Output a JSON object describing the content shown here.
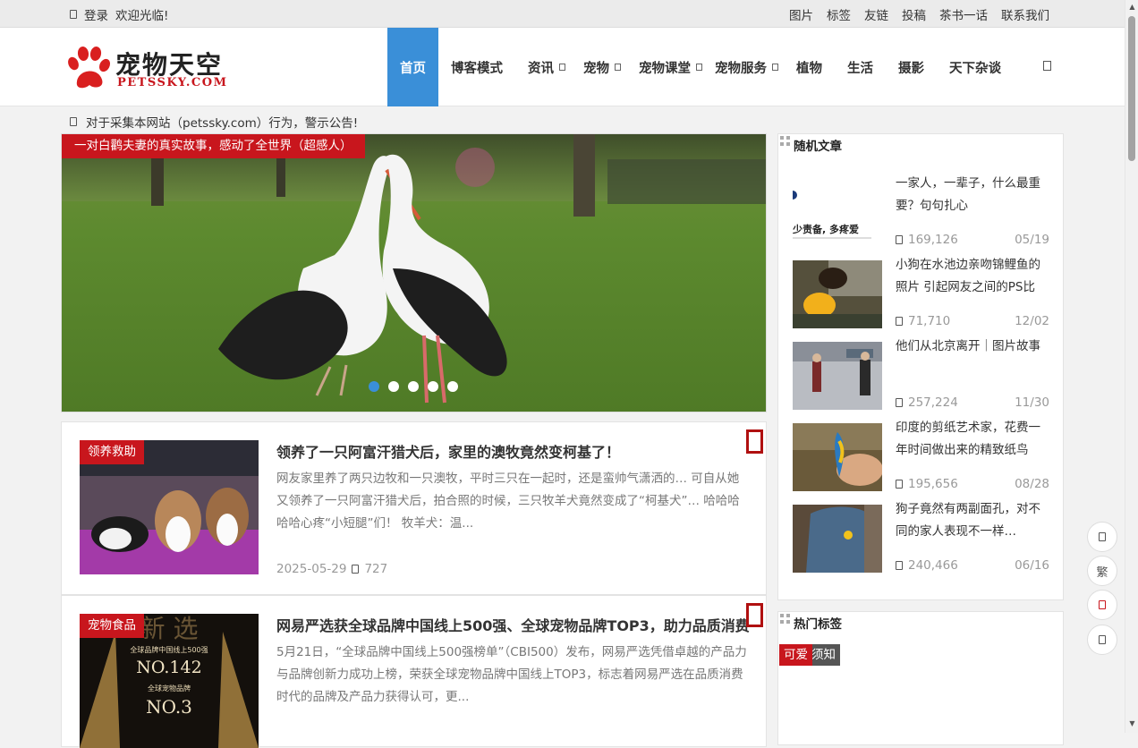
{
  "topbar": {
    "login": "登录",
    "welcome": "欢迎光临!",
    "links": [
      "图片",
      "标签",
      "友链",
      "投稿",
      "茶书一话",
      "联系我们"
    ]
  },
  "logo": {
    "cn": "宠物天空",
    "en": "PETSSKY.COM"
  },
  "nav": {
    "items": [
      "首页",
      "博客模式",
      "资讯",
      "宠物",
      "宠物课堂",
      "宠物服务",
      "植物",
      "生活",
      "摄影",
      "天下杂谈"
    ]
  },
  "notice": "对于采集本网站（petssky.com）行为，警示公告!",
  "slider": {
    "caption": "一对白鹳夫妻的真实故事，感动了全世界（超感人）",
    "active_dot": 1,
    "dot_count": 5
  },
  "posts": [
    {
      "tag": "领养救助",
      "title": "领养了一只阿富汗猎犬后，家里的澳牧竟然变柯基了！",
      "excerpt": "网友家里养了两只边牧和一只澳牧，平时三只在一起时，还是蛮帅气潇洒的… 可自从她又领养了一只阿富汗猎犬后，拍合照的时候，三只牧羊犬竟然变成了“柯基犬”… 哈哈哈哈哈心疼“小短腿”们！ 牧羊犬：温...",
      "date": "2025-05-29",
      "views": "727"
    },
    {
      "tag": "宠物食品",
      "title": "网易严选获全球品牌中国线上500强、全球宠物品牌TOP3，助力品质消费",
      "excerpt": "5月21日，“全球品牌中国线上500强榜单”（CBI500）发布，网易严选凭借卓越的产品力与品牌创新力成功上榜，荣获全球宠物品牌中国线上TOP3，标志着网易严选在品质消费时代的品牌及产品力获得认可，更...",
      "thumb_text": {
        "top": "新 选",
        "rank1_label": "全球品牌中国线上500强",
        "rank1": "NO.142",
        "rank2_label": "全球宠物品牌",
        "rank2": "NO.3"
      }
    }
  ],
  "sidebar": {
    "random_title": "随机文章",
    "random": [
      {
        "title": "一家人，一辈子，什么最重要？句句扎心",
        "views": "169,126",
        "date": "05/19",
        "thumb_text": "少责备, 多疼爱"
      },
      {
        "title": "小狗在水池边亲吻锦鲤鱼的照片 引起网友之间的PS比",
        "views": "71,710",
        "date": "12/02"
      },
      {
        "title": "他们从北京离开｜图片故事",
        "views": "257,224",
        "date": "11/30"
      },
      {
        "title": "印度的剪纸艺术家，花费一年时间做出来的精致纸鸟",
        "views": "195,656",
        "date": "08/28"
      },
      {
        "title": "狗子竟然有两副面孔，对不同的家人表现不一样…",
        "views": "240,466",
        "date": "06/16"
      }
    ],
    "hot_tags_title": "热门标签",
    "hot_tags": [
      {
        "label": "可爱",
        "color": "#c8161d"
      },
      {
        "label": "须知",
        "color": "#555555"
      }
    ]
  },
  "float_buttons": {
    "traditional": "繁"
  }
}
